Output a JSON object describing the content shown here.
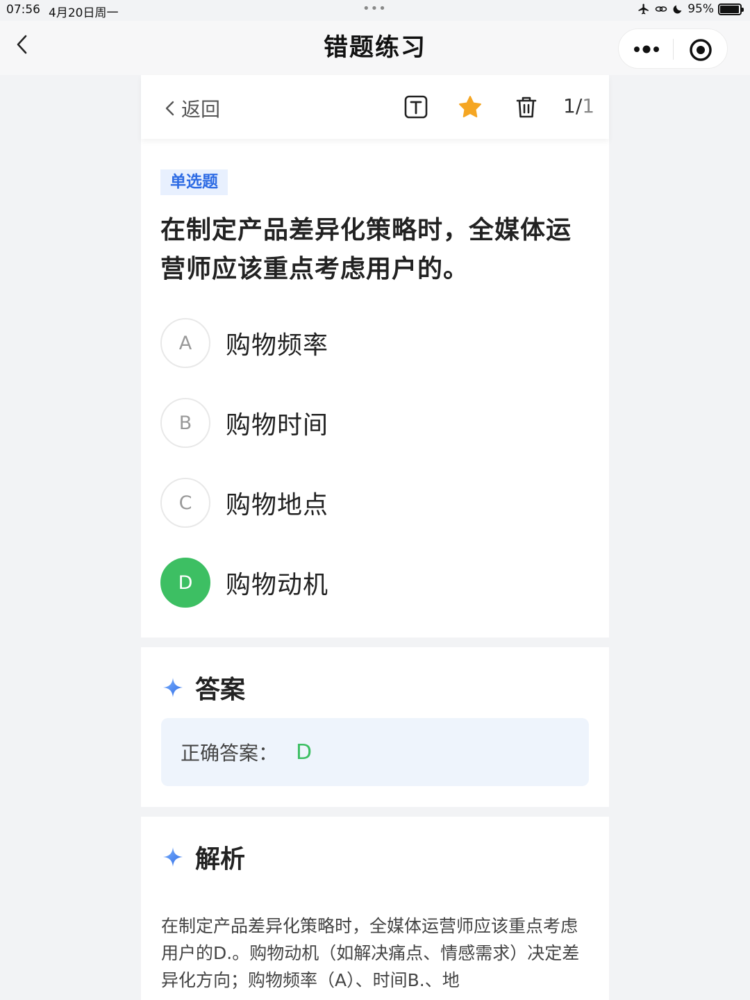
{
  "status_bar": {
    "time": "07:56",
    "date": "4月20日周一",
    "dots": "•••",
    "battery": "95%",
    "battery_level": 0.95
  },
  "nav": {
    "title": "错题练习"
  },
  "toolbar": {
    "back_label": "返回",
    "page_current": "1/",
    "page_total": "1",
    "star_color": "#f5a623"
  },
  "question": {
    "type_label": "单选题",
    "text": "在制定产品差异化策略时，全媒体运营师应该重点考虑用户的。",
    "options": [
      {
        "letter": "A",
        "text": "购物频率",
        "selected": false
      },
      {
        "letter": "B",
        "text": "购物时间",
        "selected": false
      },
      {
        "letter": "C",
        "text": "购物地点",
        "selected": false
      },
      {
        "letter": "D",
        "text": "购物动机",
        "selected": true
      }
    ]
  },
  "answer": {
    "title": "答案",
    "label": "正确答案：",
    "value": "D"
  },
  "analysis": {
    "title": "解析",
    "text": "在制定产品差异化策略时，全媒体运营师应该重点考虑用户的D.。购物动机（如解决痛点、情感需求）决定差异化方向；购物频率（A）、时间B.、地"
  },
  "colors": {
    "accent_blue": "#2d6be4",
    "correct_green": "#3dbf63",
    "background": "#f2f3f5"
  }
}
